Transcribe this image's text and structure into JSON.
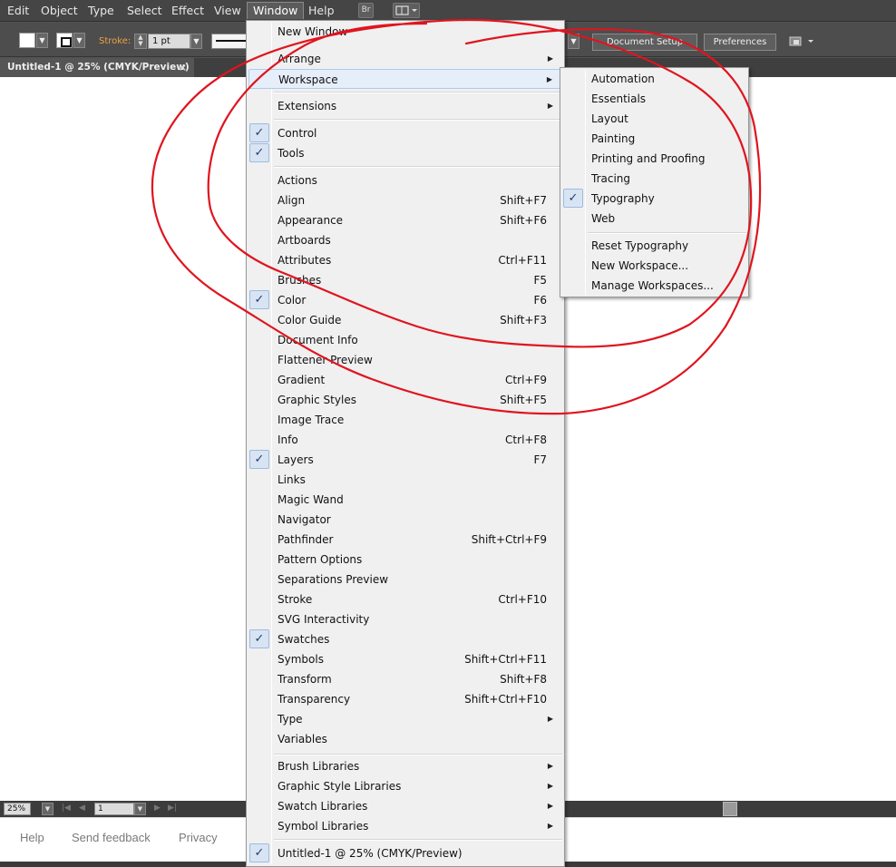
{
  "menubar": {
    "items": [
      "Edit",
      "Object",
      "Type",
      "Select",
      "Effect",
      "View",
      "Window",
      "Help"
    ],
    "active": "Window",
    "bridge_label": "Br"
  },
  "control_bar": {
    "stroke_label": "Stroke:",
    "stroke_weight": "1 pt",
    "document_setup": "Document Setup",
    "preferences": "Preferences"
  },
  "document_tab": {
    "title": "Untitled-1 @ 25% (CMYK/Preview)",
    "close": "×"
  },
  "window_menu": {
    "top_items": [
      {
        "label": "New Window",
        "submenu": false
      },
      {
        "label": "Arrange",
        "submenu": true
      },
      {
        "label": "Workspace",
        "submenu": true,
        "highlighted": true
      }
    ],
    "extensions": {
      "label": "Extensions",
      "submenu": true
    },
    "control_items": [
      {
        "label": "Control",
        "checked": true
      },
      {
        "label": "Tools",
        "checked": true
      }
    ],
    "panel_items": [
      {
        "label": "Actions",
        "shortcut": "",
        "checked": false
      },
      {
        "label": "Align",
        "shortcut": "Shift+F7",
        "checked": false
      },
      {
        "label": "Appearance",
        "shortcut": "Shift+F6",
        "checked": false
      },
      {
        "label": "Artboards",
        "shortcut": "",
        "checked": false
      },
      {
        "label": "Attributes",
        "shortcut": "Ctrl+F11",
        "checked": false
      },
      {
        "label": "Brushes",
        "shortcut": "F5",
        "checked": false
      },
      {
        "label": "Color",
        "shortcut": "F6",
        "checked": true
      },
      {
        "label": "Color Guide",
        "shortcut": "Shift+F3",
        "checked": false
      },
      {
        "label": "Document Info",
        "shortcut": "",
        "checked": false
      },
      {
        "label": "Flattener Preview",
        "shortcut": "",
        "checked": false
      },
      {
        "label": "Gradient",
        "shortcut": "Ctrl+F9",
        "checked": false
      },
      {
        "label": "Graphic Styles",
        "shortcut": "Shift+F5",
        "checked": false
      },
      {
        "label": "Image Trace",
        "shortcut": "",
        "checked": false
      },
      {
        "label": "Info",
        "shortcut": "Ctrl+F8",
        "checked": false
      },
      {
        "label": "Layers",
        "shortcut": "F7",
        "checked": true
      },
      {
        "label": "Links",
        "shortcut": "",
        "checked": false
      },
      {
        "label": "Magic Wand",
        "shortcut": "",
        "checked": false
      },
      {
        "label": "Navigator",
        "shortcut": "",
        "checked": false
      },
      {
        "label": "Pathfinder",
        "shortcut": "Shift+Ctrl+F9",
        "checked": false
      },
      {
        "label": "Pattern Options",
        "shortcut": "",
        "checked": false
      },
      {
        "label": "Separations Preview",
        "shortcut": "",
        "checked": false
      },
      {
        "label": "Stroke",
        "shortcut": "Ctrl+F10",
        "checked": false
      },
      {
        "label": "SVG Interactivity",
        "shortcut": "",
        "checked": false
      },
      {
        "label": "Swatches",
        "shortcut": "",
        "checked": true
      },
      {
        "label": "Symbols",
        "shortcut": "Shift+Ctrl+F11",
        "checked": false
      },
      {
        "label": "Transform",
        "shortcut": "Shift+F8",
        "checked": false
      },
      {
        "label": "Transparency",
        "shortcut": "Shift+Ctrl+F10",
        "checked": false
      },
      {
        "label": "Type",
        "shortcut": "",
        "checked": false,
        "submenu": true
      },
      {
        "label": "Variables",
        "shortcut": "",
        "checked": false
      }
    ],
    "library_items": [
      {
        "label": "Brush Libraries",
        "submenu": true
      },
      {
        "label": "Graphic Style Libraries",
        "submenu": true
      },
      {
        "label": "Swatch Libraries",
        "submenu": true
      },
      {
        "label": "Symbol Libraries",
        "submenu": true
      }
    ],
    "document_items": [
      {
        "label": "Untitled-1 @ 25% (CMYK/Preview)",
        "checked": true
      }
    ]
  },
  "workspace_menu": {
    "items": [
      {
        "label": "Automation",
        "checked": false
      },
      {
        "label": "Essentials",
        "checked": false
      },
      {
        "label": "Layout",
        "checked": false
      },
      {
        "label": "Painting",
        "checked": false
      },
      {
        "label": "Printing and Proofing",
        "checked": false
      },
      {
        "label": "Tracing",
        "checked": false
      },
      {
        "label": "Typography",
        "checked": true
      },
      {
        "label": "Web",
        "checked": false
      }
    ],
    "actions": [
      {
        "label": "Reset Typography"
      },
      {
        "label": "New Workspace..."
      },
      {
        "label": "Manage Workspaces..."
      }
    ]
  },
  "status_bar": {
    "zoom": "25%",
    "artboard": "1"
  },
  "footer": {
    "links": [
      "Help",
      "Send feedback",
      "Privacy"
    ]
  },
  "icons": {
    "check": "✓",
    "submenu_arrow": "▶",
    "dropdown_arrow": "▼"
  },
  "colors": {
    "annotation": "#e0141e",
    "menu_bg": "#f0f0f0",
    "highlight": "#e5eef9",
    "check_blue": "#1e3f7a",
    "stroke_label": "#f0a040"
  }
}
